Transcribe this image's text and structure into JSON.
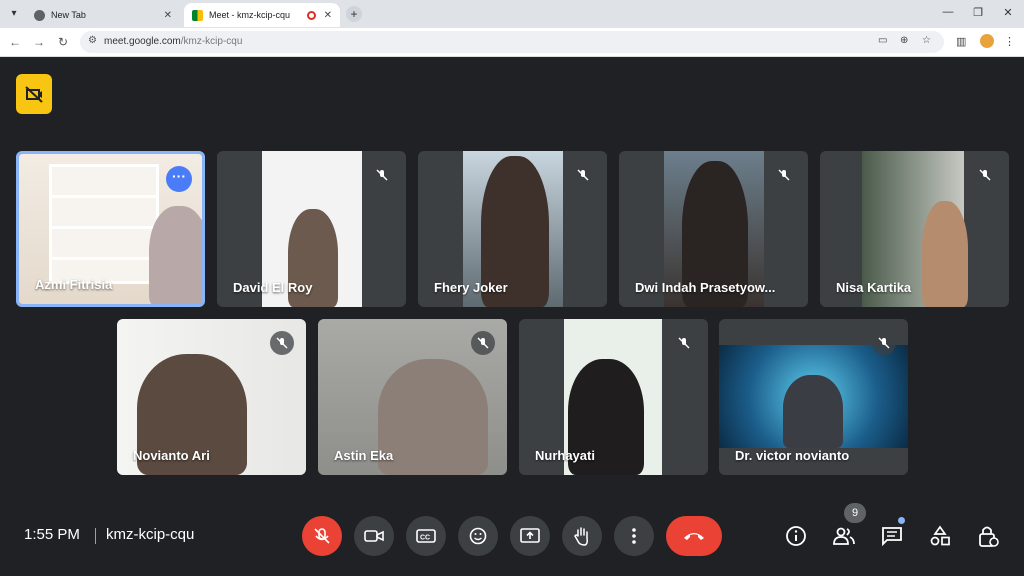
{
  "browser": {
    "tabs": [
      {
        "title": "New Tab",
        "active": false
      },
      {
        "title": "Meet - kmz-kcip-cqu",
        "active": true
      }
    ],
    "url_host": "meet.google.com",
    "url_path": "/kmz-kcip-cqu"
  },
  "meeting": {
    "time": "1:55 PM",
    "code": "kmz-kcip-cqu",
    "participant_count": "9"
  },
  "participants": [
    {
      "name": "Azmi Fitrisia",
      "muted": false,
      "speaking": true
    },
    {
      "name": "David El Roy",
      "muted": true
    },
    {
      "name": "Fhery Joker",
      "muted": true
    },
    {
      "name": "Dwi Indah Prasetyow...",
      "muted": true
    },
    {
      "name": "Nisa Kartika",
      "muted": true
    },
    {
      "name": "Novianto Ari",
      "muted": true
    },
    {
      "name": "Astin Eka",
      "muted": true
    },
    {
      "name": "Nurhayati",
      "muted": true
    },
    {
      "name": "Dr. victor novianto",
      "muted": true
    }
  ],
  "colors": {
    "accent": "#8ab4f8",
    "danger": "#ea4335",
    "badge": "#f9c513"
  },
  "icons": [
    "mic-off-icon",
    "camera-icon",
    "captions-icon",
    "emoji-icon",
    "present-icon",
    "raise-hand-icon",
    "more-options-icon",
    "end-call-icon",
    "info-icon",
    "people-icon",
    "chat-icon",
    "activities-icon",
    "host-controls-icon"
  ]
}
